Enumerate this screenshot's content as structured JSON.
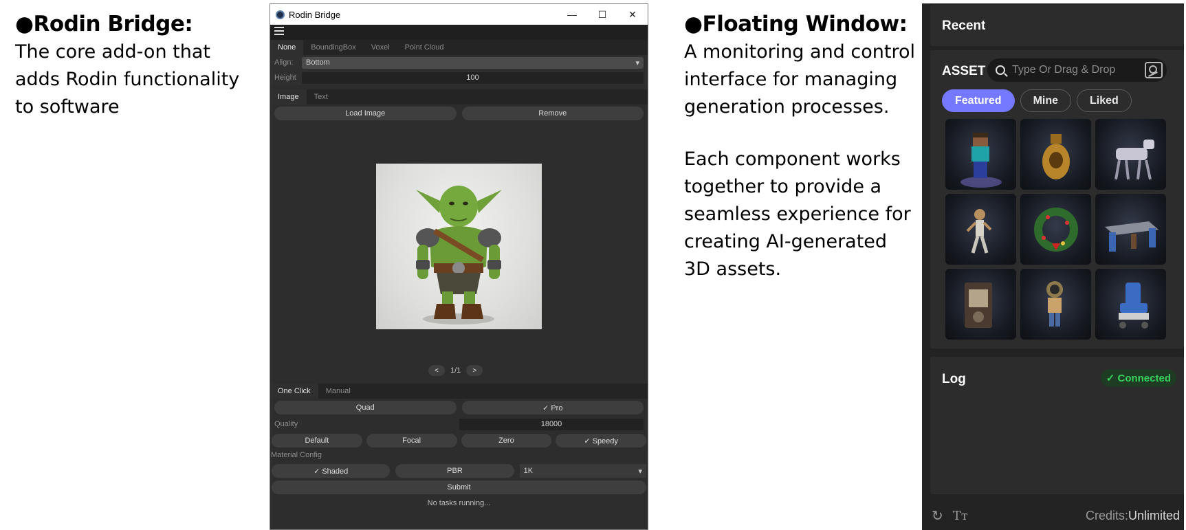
{
  "left_description": {
    "title": "●Rodin Bridge:",
    "body": "The core add-on that adds Rodin functionality to software"
  },
  "right_description": {
    "title": "●Floating Window:",
    "body_1": "A monitoring and control interface for managing generation processes.",
    "body_2": "Each component works together to provide a seamless experience for creating AI-generated 3D assets."
  },
  "rodin_window": {
    "title": "Rodin Bridge",
    "window_controls": {
      "minimize": "—",
      "maximize": "☐",
      "close": "✕"
    },
    "bbox_tabs": [
      "None",
      "BoundingBox",
      "Voxel",
      "Point Cloud"
    ],
    "align_label": "Align:",
    "align_value": "Bottom",
    "height_label": "Height",
    "height_value": "100",
    "input_tabs": [
      "Image",
      "Text"
    ],
    "load_image_label": "Load Image",
    "remove_label": "Remove",
    "pager": {
      "prev": "<",
      "text": "1/1",
      "next": ">"
    },
    "mode_tabs": [
      "One Click",
      "Manual"
    ],
    "quad_label": "Quad",
    "pro_label": "✓ Pro",
    "quality_label": "Quality",
    "quality_value": "18000",
    "presets": [
      "Default",
      "Focal",
      "Zero",
      "✓ Speedy"
    ],
    "material_config_label": "Material Config",
    "material_options": [
      "✓ Shaded",
      "PBR"
    ],
    "resolution_value": "1K",
    "submit_label": "Submit",
    "status_text": "No tasks running..."
  },
  "floating_window": {
    "recent_label": "Recent",
    "asset_label": "ASSET",
    "search_placeholder": "Type Or Drag & Drop",
    "filters": [
      "Featured",
      "Mine",
      "Liked"
    ],
    "log_label": "Log",
    "connected_label": "✓ Connected",
    "credits_label": "Credits:",
    "credits_value": "Unlimited",
    "colors": {
      "accent": "#7479ff",
      "connected": "#39d25c"
    }
  }
}
